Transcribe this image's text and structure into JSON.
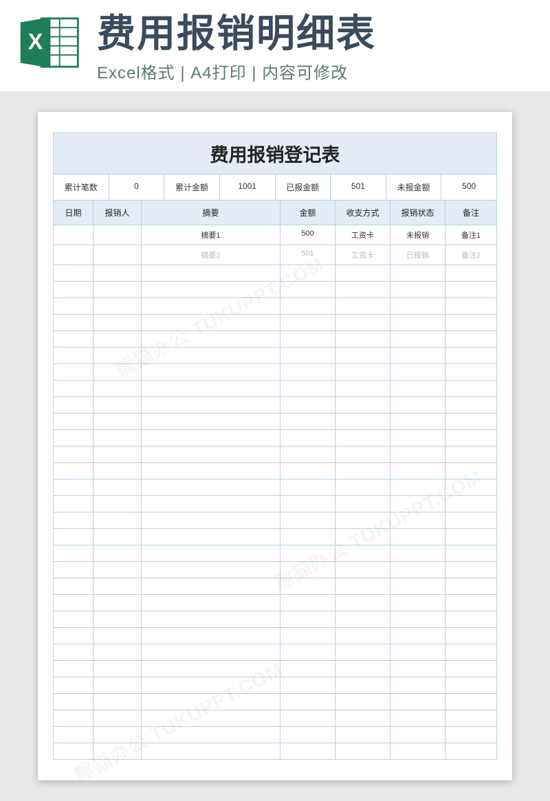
{
  "header": {
    "title": "费用报销明细表",
    "subtitle": "Excel格式 | A4打印 | 内容可修改",
    "icon_label": "X"
  },
  "table": {
    "title": "费用报销登记表",
    "summary": {
      "count_label": "累计笔数",
      "count_value": "0",
      "total_label": "累计金额",
      "total_value": "1001",
      "reported_label": "已报金额",
      "reported_value": "501",
      "unreported_label": "未报金额",
      "unreported_value": "500"
    },
    "columns": {
      "date": "日期",
      "person": "报销人",
      "summary": "摘要",
      "amount": "金额",
      "method": "收支方式",
      "status": "报销状态",
      "note": "备注"
    },
    "rows": [
      {
        "date": "",
        "person": "",
        "summary": "摘要1",
        "amount": "500",
        "method": "工资卡",
        "status": "未报销",
        "note": "备注1",
        "faded": false
      },
      {
        "date": "",
        "person": "",
        "summary": "摘要2",
        "amount": "501",
        "method": "工资卡",
        "status": "已报销",
        "note": "备注2",
        "faded": true
      }
    ],
    "empty_rows": 30
  },
  "watermark": "熊猫办公 TUKUPPT.COM"
}
